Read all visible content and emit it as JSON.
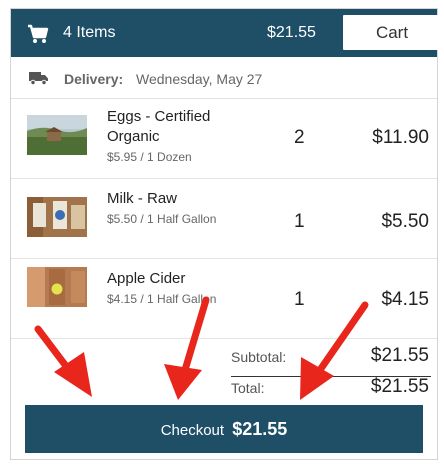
{
  "header": {
    "item_count": "4 Items",
    "total": "$21.55",
    "cart_label": "Cart",
    "cart_icon": "shopping-cart-icon",
    "color": "#1e4f66"
  },
  "delivery": {
    "icon": "truck-icon",
    "label": "Delivery:",
    "date": "Wednesday, May 27"
  },
  "items": [
    {
      "name": "Eggs - Certified Organic",
      "unit": "$5.95 / 1 Dozen",
      "qty": "2",
      "price": "$11.90"
    },
    {
      "name": "Milk - Raw",
      "unit": "$5.50 / 1 Half Gallon",
      "qty": "1",
      "price": "$5.50"
    },
    {
      "name": "Apple Cider",
      "unit": "$4.15 / 1 Half Gallon",
      "qty": "1",
      "price": "$4.15"
    }
  ],
  "summary": {
    "subtotal_label": "Subtotal:",
    "subtotal_value": "$21.55",
    "total_label": "Total:",
    "total_value": "$21.55"
  },
  "checkout": {
    "label": "Checkout",
    "amount": "$21.55"
  },
  "annotation_color": "#e8261c"
}
